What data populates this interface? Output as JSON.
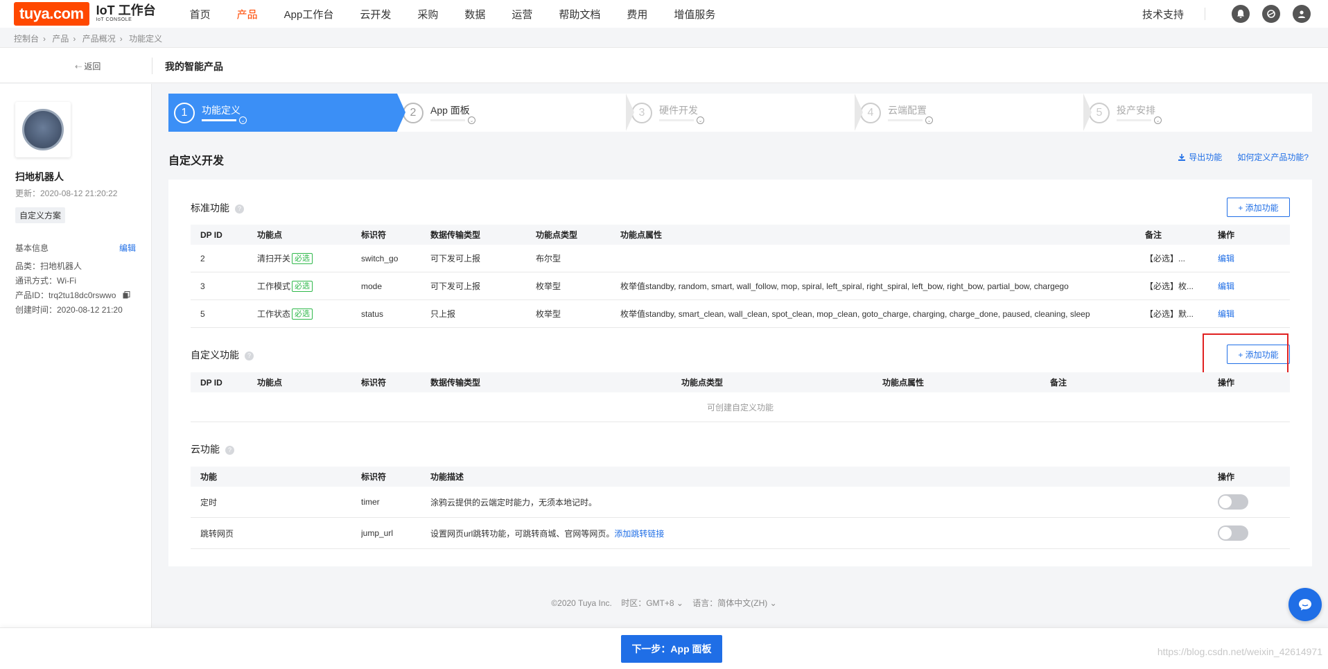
{
  "brand": {
    "logo": "tuya.com",
    "title": "IoT 工作台",
    "subtitle": "IoT CONSOLE",
    "accent": "#ff4800"
  },
  "nav": [
    {
      "label": "首页",
      "active": false
    },
    {
      "label": "产品",
      "active": true
    },
    {
      "label": "App工作台",
      "active": false
    },
    {
      "label": "云开发",
      "active": false
    },
    {
      "label": "采购",
      "active": false
    },
    {
      "label": "数据",
      "active": false
    },
    {
      "label": "运营",
      "active": false
    },
    {
      "label": "帮助文档",
      "active": false
    },
    {
      "label": "费用",
      "active": false
    },
    {
      "label": "增值服务",
      "active": false
    }
  ],
  "top_right": {
    "support": "技术支持",
    "icons": [
      "bell-icon",
      "chat-bubble-icon",
      "user-icon"
    ]
  },
  "breadcrumb": [
    "控制台",
    "产品",
    "产品概况",
    "功能定义"
  ],
  "subheader": {
    "back": "返回",
    "title": "我的智能产品"
  },
  "sidebar": {
    "name": "扫地机器人",
    "updated": "更新：2020-08-12 21:20:22",
    "tag": "自定义方案",
    "basic_label": "基本信息",
    "edit_label": "编辑",
    "category": "品类：扫地机器人",
    "protocol": "通讯方式：Wi-Fi",
    "product_id": "产品ID：trq2tu18dc0rswwo",
    "created": "创建时间：2020-08-12 21:20"
  },
  "steps": [
    {
      "num": "1",
      "label": "功能定义",
      "active": true
    },
    {
      "num": "2",
      "label": "App 面板",
      "active": false
    },
    {
      "num": "3",
      "label": "硬件开发",
      "active": false
    },
    {
      "num": "4",
      "label": "云端配置",
      "active": false
    },
    {
      "num": "5",
      "label": "投产安排",
      "active": false
    }
  ],
  "main": {
    "title": "自定义开发",
    "export_label": "导出功能",
    "help_label": "如何定义产品功能?"
  },
  "standard": {
    "title": "标准功能",
    "add_label": "+ 添加功能",
    "headers": [
      "DP ID",
      "功能点",
      "标识符",
      "数据传输类型",
      "功能点类型",
      "功能点属性",
      "备注",
      "操作"
    ],
    "required_label": "必选",
    "rows": [
      {
        "id": "2",
        "name": "清扫开关",
        "code": "switch_go",
        "transfer": "可下发可上报",
        "type": "布尔型",
        "attr": "",
        "note": "【必选】...",
        "op": "编辑"
      },
      {
        "id": "3",
        "name": "工作模式",
        "code": "mode",
        "transfer": "可下发可上报",
        "type": "枚举型",
        "attr": "枚举值standby, random, smart, wall_follow, mop, spiral, left_spiral, right_spiral, left_bow, right_bow, partial_bow, chargego",
        "note": "【必选】枚...",
        "op": "编辑"
      },
      {
        "id": "5",
        "name": "工作状态",
        "code": "status",
        "transfer": "只上报",
        "type": "枚举型",
        "attr": "枚举值standby, smart_clean, wall_clean, spot_clean, mop_clean, goto_charge, charging, charge_done, paused, cleaning, sleep",
        "note": "【必选】默...",
        "op": "编辑"
      }
    ]
  },
  "custom": {
    "title": "自定义功能",
    "add_label": "+ 添加功能",
    "headers": [
      "DP ID",
      "功能点",
      "标识符",
      "数据传输类型",
      "功能点类型",
      "功能点属性",
      "备注",
      "操作"
    ],
    "empty": "可创建自定义功能"
  },
  "cloud": {
    "title": "云功能",
    "headers": [
      "功能",
      "标识符",
      "功能描述",
      "操作"
    ],
    "rows": [
      {
        "name": "定时",
        "code": "timer",
        "desc": "涂鸦云提供的云端定时能力，无须本地记时。",
        "link": "",
        "enabled": false
      },
      {
        "name": "跳转网页",
        "code": "jump_url",
        "desc": "设置网页url跳转功能，可跳转商城、官网等网页。",
        "link": "添加跳转链接",
        "enabled": false
      }
    ]
  },
  "footer": {
    "copyright": "©2020 Tuya Inc.",
    "timezone": "时区：GMT+8",
    "language": "语言：简体中文(ZH)"
  },
  "bottom": {
    "next_label": "下一步：App 面板",
    "watermark": "https://blog.csdn.net/weixin_42614971"
  },
  "colors": {
    "primary": "#1f6ee6",
    "step_active": "#3b8ff6",
    "highlight": "#e02020",
    "required": "#2eb84a"
  }
}
